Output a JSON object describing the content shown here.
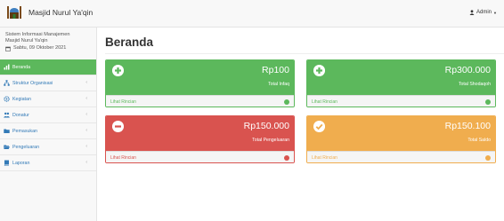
{
  "header": {
    "brand": "Masjid Nurul Ya'qin",
    "admin_label": "Admin"
  },
  "sidebar": {
    "system_name_line1": "Sistem Informasi Manajemen",
    "system_name_line2": "Masjid Nurul Ya'qin",
    "date": "Sabtu, 09 Oktober 2021",
    "items": [
      {
        "label": "Beranda",
        "icon": "dashboard-icon",
        "active": true,
        "has_submenu": false
      },
      {
        "label": "Struktur Organisasi",
        "icon": "sitemap-icon",
        "active": false,
        "has_submenu": true
      },
      {
        "label": "Kegiatan",
        "icon": "gear-icon",
        "active": false,
        "has_submenu": true
      },
      {
        "label": "Donatur",
        "icon": "users-icon",
        "active": false,
        "has_submenu": true
      },
      {
        "label": "Pemasukan",
        "icon": "folder-icon",
        "active": false,
        "has_submenu": true
      },
      {
        "label": "Pengeluaran",
        "icon": "folder-open-icon",
        "active": false,
        "has_submenu": true
      },
      {
        "label": "Laporan",
        "icon": "book-icon",
        "active": false,
        "has_submenu": true
      }
    ]
  },
  "main": {
    "page_title": "Beranda",
    "cards": [
      {
        "amount": "Rp100",
        "label": "Total Infaq",
        "link": "Lihat Rincian",
        "icon": "plus-circle-icon",
        "color": "#5cb85c"
      },
      {
        "amount": "Rp300.000",
        "label": "Total Shodaqoh",
        "link": "Lihat Rincian",
        "icon": "plus-circle-icon",
        "color": "#5cb85c"
      },
      {
        "amount": "Rp150.000",
        "label": "Total Pengeluaran",
        "link": "Lihat Rincian",
        "icon": "minus-circle-icon",
        "color": "#d9534f"
      },
      {
        "amount": "Rp150.100",
        "label": "Total Saldo",
        "link": "Lihat Rincian",
        "icon": "check-circle-icon",
        "color": "#f0ad4e"
      }
    ]
  }
}
